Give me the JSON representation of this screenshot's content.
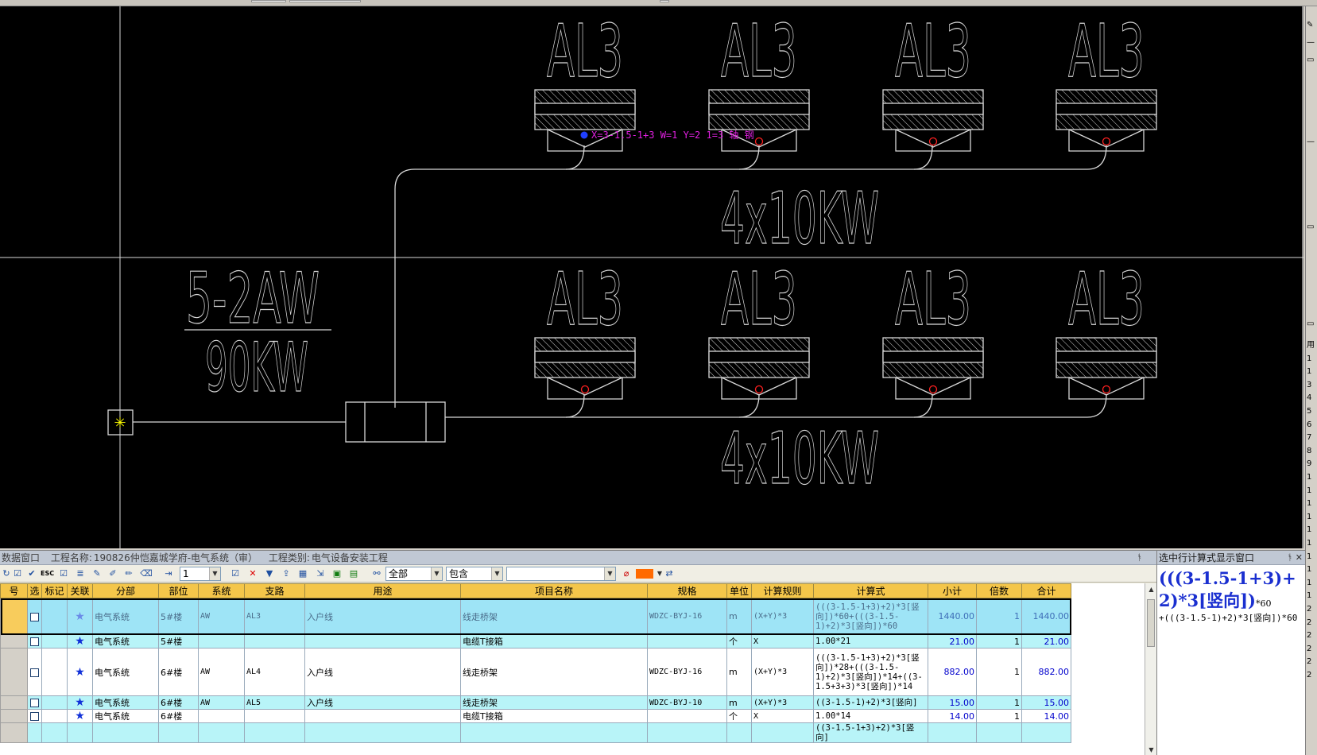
{
  "cad": {
    "board_labels": [
      "AL3",
      "AL3",
      "AL3",
      "AL3",
      "AL3",
      "AL3",
      "AL3",
      "AL3"
    ],
    "group_label_top": "4x10KW",
    "group_label_bottom": "4x10KW",
    "main_board_label": "5-2AW",
    "main_board_power": "90KW",
    "snap_tooltip": "X=3-1.5-1+3 W=1 Y=2 1=3 轴 钢",
    "colors": {
      "background": "#000000",
      "lines": "#d8d8d8",
      "accent_magenta": "#e020e0",
      "marker_red": "#ff2020",
      "marker_blue": "#2040ff",
      "marker_yellow": "#ffff00"
    }
  },
  "side": {
    "rows": [
      "用",
      "1",
      "1",
      "3",
      "4",
      "5",
      "6",
      "7",
      "8",
      "9",
      "1",
      "1",
      "1",
      "1",
      "1",
      "1",
      "1",
      "1",
      "1",
      "1",
      "2",
      "2",
      "2",
      "2",
      "2",
      "2"
    ]
  },
  "datapanel": {
    "title_prefix": "数据窗口",
    "project_label": "工程名称:",
    "project_name": "190826仲恺嘉城学府-电气系统（审）",
    "category_label": "工程类别:",
    "category_name": "电气设备安装工程",
    "pin": "ᚬ"
  },
  "toolbar": {
    "level_value": "1",
    "filter_value": "全部",
    "match_value": "包含",
    "search_value": "",
    "icons": [
      "esc-icon",
      "grid-icon",
      "edit-icon",
      "check-icon",
      "delete-icon",
      "filter-icon",
      "import-icon",
      "export-icon",
      "excel-icon",
      "binoculars-icon",
      "color-icon",
      "refresh-icon"
    ]
  },
  "grid": {
    "columns": [
      "号",
      "选",
      "标记",
      "关联",
      "分部",
      "部位",
      "系统",
      "支路",
      "用途",
      "项目名称",
      "规格",
      "单位",
      "计算规则",
      "计算式",
      "小计",
      "倍数",
      "合计"
    ],
    "rows": [
      {
        "style": "sel",
        "fenbu": "电气系统",
        "buwei": "5#楼",
        "xitong": "AW",
        "zhilu": "AL3",
        "yongtu": "入户线",
        "mingcheng": "线走桥架",
        "guige": "WDZC-BYJ-16",
        "danwei": "m",
        "guize": "(X+Y)*3",
        "jisuanshi": "(((3-1.5-1+3)+2)*3[竖向])*60+(((3-1.5-1)+2)*3[竖向])*60",
        "xiaoji": "1440.00",
        "beishu": "1",
        "heji": "1440.00"
      },
      {
        "style": "cyan",
        "fenbu": "电气系统",
        "buwei": "5#楼",
        "xitong": "",
        "zhilu": "",
        "yongtu": "",
        "mingcheng": "电缆T接箱",
        "guige": "",
        "danwei": "个",
        "guize": "X",
        "jisuanshi": "1.00*21",
        "xiaoji": "21.00",
        "beishu": "1",
        "heji": "21.00"
      },
      {
        "style": "white",
        "fenbu": "电气系统",
        "buwei": "6#楼",
        "xitong": "AW",
        "zhilu": "AL4",
        "yongtu": "入户线",
        "mingcheng": "线走桥架",
        "guige": "WDZC-BYJ-16",
        "danwei": "m",
        "guize": "(X+Y)*3",
        "jisuanshi": "(((3-1.5-1+3)+2)*3[竖向])*28+(((3-1.5-1)+2)*3[竖向])*14+((3-1.5+3+3)*3[竖向])*14",
        "xiaoji": "882.00",
        "beishu": "1",
        "heji": "882.00"
      },
      {
        "style": "cyan",
        "fenbu": "电气系统",
        "buwei": "6#楼",
        "xitong": "AW",
        "zhilu": "AL5",
        "yongtu": "入户线",
        "mingcheng": "线走桥架",
        "guige": "WDZC-BYJ-10",
        "danwei": "m",
        "guize": "(X+Y)*3",
        "jisuanshi": "((3-1.5-1)+2)*3[竖向]",
        "xiaoji": "15.00",
        "beishu": "1",
        "heji": "15.00"
      },
      {
        "style": "white",
        "fenbu": "电气系统",
        "buwei": "6#楼",
        "xitong": "",
        "zhilu": "",
        "yongtu": "",
        "mingcheng": "电缆T接箱",
        "guige": "",
        "danwei": "个",
        "guize": "X",
        "jisuanshi": "1.00*14",
        "xiaoji": "14.00",
        "beishu": "1",
        "heji": "14.00"
      },
      {
        "style": "cyan",
        "fenbu": "",
        "buwei": "",
        "xitong": "",
        "zhilu": "",
        "yongtu": "",
        "mingcheng": "",
        "guige": "",
        "danwei": "",
        "guize": "",
        "jisuanshi": "((3-1.5-1+3)+2)*3[竖向]",
        "xiaoji": "",
        "beishu": "",
        "heji": ""
      }
    ]
  },
  "formula": {
    "title": "选中行计算式显示窗口",
    "big": "(((3-1.5-1+3)+2)*3[竖向])",
    "big_suffix": "*60",
    "small": "+(((3-1.5-1)+2)*3[竖向])*60"
  }
}
